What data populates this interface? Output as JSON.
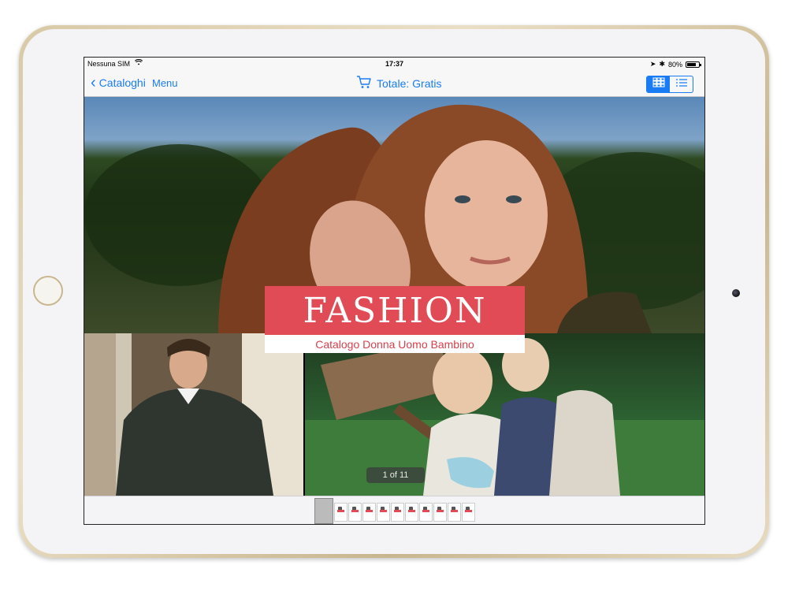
{
  "status_bar": {
    "carrier": "Nessuna SIM",
    "wifi_icon": "wifi-icon",
    "time": "17:37",
    "battery_percent": "80%",
    "battery_level": 0.8
  },
  "nav": {
    "back_label": "Cataloghi",
    "menu_label": "Menu",
    "total_label": "Totale: Gratis",
    "cart_icon": "cart-icon",
    "view_modes": [
      "grid-view-icon",
      "list-view-icon"
    ],
    "active_view": "grid"
  },
  "cover": {
    "title": "FASHION",
    "subtitle": "Catalogo Donna Uomo Bambino"
  },
  "pager": {
    "page_indicator": "1 of 11",
    "thumbnail_count": 11,
    "current_page": 1
  },
  "colors": {
    "accent": "#1a7cf5",
    "title_red": "#e04b55",
    "ipad_frame": "#d8c9a6"
  }
}
